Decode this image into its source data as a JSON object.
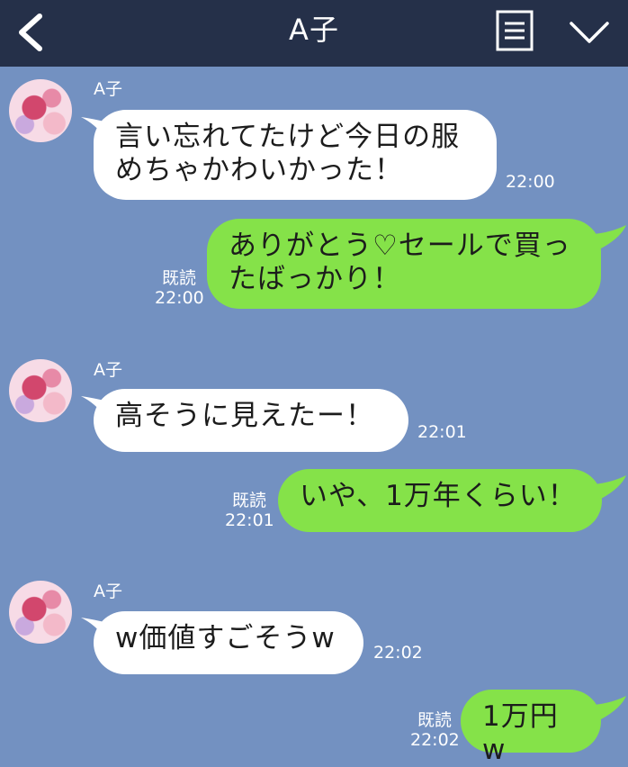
{
  "header": {
    "title": "A子"
  },
  "messages": [
    {
      "side": "in",
      "sender": "A子",
      "line1": "言い忘れてたけど今日の服",
      "line2": "めちゃかわいかった！",
      "time": "22:00"
    },
    {
      "side": "out",
      "line1": "ありがとう♡セールで買っ",
      "line2": "たばっかり！",
      "read": "既読",
      "time": "22:00"
    },
    {
      "side": "in",
      "sender": "A子",
      "text": "高そうに見えたー！",
      "time": "22:01"
    },
    {
      "side": "out",
      "text": "いや、1万年くらい！",
      "read": "既読",
      "time": "22:01"
    },
    {
      "side": "in",
      "sender": "A子",
      "text": "w価値すごそうw",
      "time": "22:02"
    },
    {
      "side": "out",
      "text": "1万円w",
      "read": "既読",
      "time": "22:02"
    }
  ],
  "colors": {
    "header": "#253049",
    "background": "#7391c1",
    "incoming": "#ffffff",
    "outgoing": "#85e249"
  },
  "icons": [
    "back-arrow-icon",
    "menu-icon",
    "chevron-down-icon",
    "avatar"
  ]
}
